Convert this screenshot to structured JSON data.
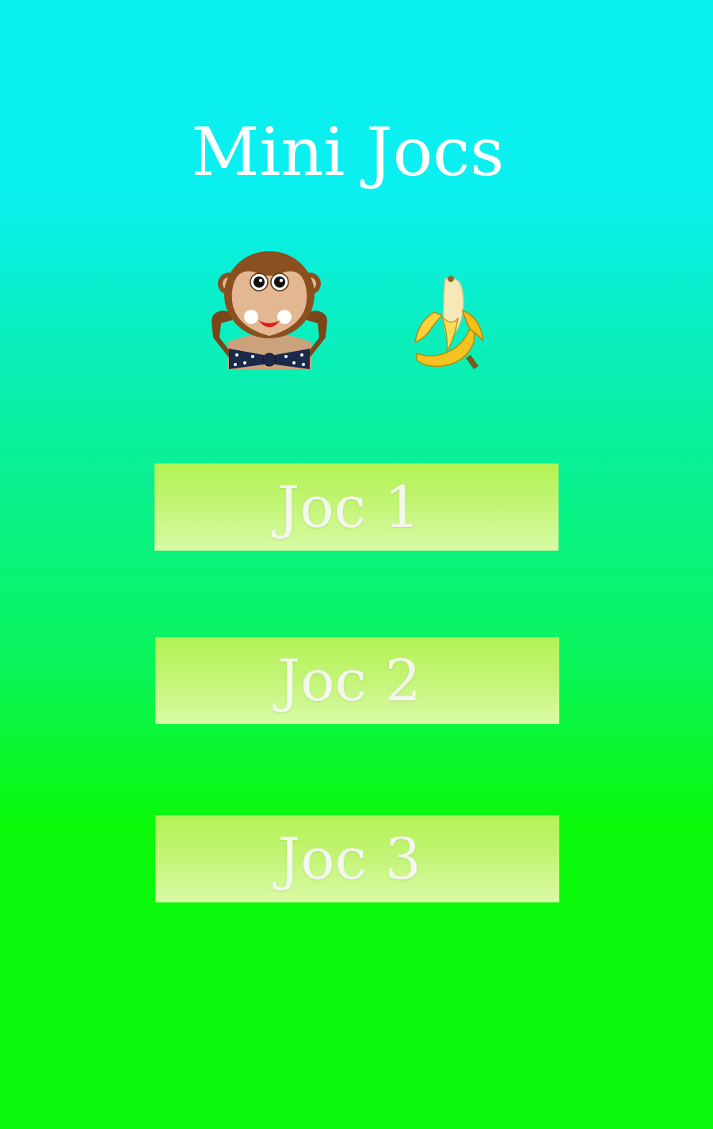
{
  "title": "Mini Jocs",
  "images": {
    "monkey": "monkey-icon",
    "banana": "banana-icon"
  },
  "buttons": [
    {
      "label": "Joc 1"
    },
    {
      "label": "Joc 2"
    },
    {
      "label": "Joc 3"
    }
  ],
  "colors": {
    "background_top": "#0aeff0",
    "background_bottom": "#0af80a",
    "button_top": "#b2f354",
    "button_bottom": "#d9fba6",
    "text": "#ffffff"
  }
}
